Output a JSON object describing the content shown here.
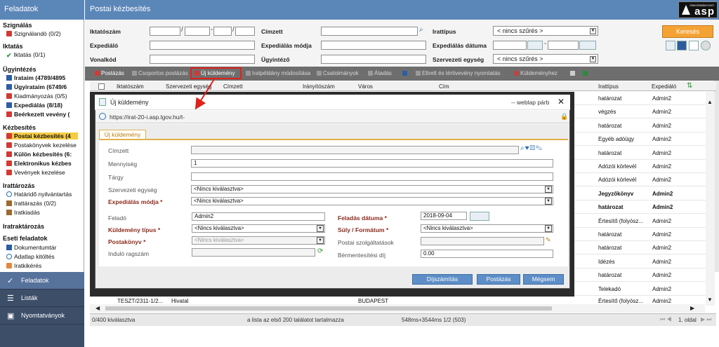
{
  "sidebar": {
    "title": "Feladatok",
    "sections": [
      {
        "title": "Szignálás",
        "items": [
          {
            "label": "Szignálandó (0/2)",
            "icon": "red-folder-icon"
          }
        ]
      },
      {
        "title": "Iktatás",
        "items": [
          {
            "label": "Iktatás (0/1)",
            "icon": "check-icon"
          }
        ]
      },
      {
        "title": "Ügyintézés",
        "items": [
          {
            "label": "Irataim (4789/4895",
            "icon": "blue-doc-icon"
          },
          {
            "label": "Ügyirataim (6749/6",
            "icon": "blue-doc-icon"
          },
          {
            "label": "Kiadmányozás (0/5)",
            "icon": "red-doc-icon"
          },
          {
            "label": "Expediálás (8/18)",
            "icon": "blue-doc-icon"
          },
          {
            "label": "Beérkezett vevény (",
            "icon": "red-doc-icon"
          }
        ]
      },
      {
        "title": "Kézbesítés",
        "items": [
          {
            "label": "Postai kézbesítés (4",
            "icon": "red-doc-icon"
          },
          {
            "label": "Postakönyvek kezelése",
            "icon": "red-doc-icon"
          },
          {
            "label": "Külön kézbesítés (6:",
            "icon": "red-doc-icon"
          },
          {
            "label": "Elektronikus kézbes",
            "icon": "red-doc-icon"
          },
          {
            "label": "Vevények kezelése",
            "icon": "red-doc-icon"
          }
        ]
      },
      {
        "title": "Irattározás",
        "items": [
          {
            "label": "Határidő nyilvántartás",
            "icon": "clock-icon"
          },
          {
            "label": "Irattárazás (0/2)",
            "icon": "box-icon"
          },
          {
            "label": "Iratkiadás",
            "icon": "box-icon"
          }
        ]
      },
      {
        "title": "Iratraktározás",
        "items": []
      },
      {
        "title": "Eseti feladatok",
        "items": [
          {
            "label": "Dokumentumtár",
            "icon": "word-icon"
          },
          {
            "label": "Adatlap kitöltés",
            "icon": "form-icon"
          },
          {
            "label": "Iratkikérés",
            "icon": "request-icon"
          }
        ]
      }
    ],
    "nav": [
      {
        "label": "Feladatok",
        "icon": "check-icon"
      },
      {
        "label": "Listák",
        "icon": "list-icon"
      },
      {
        "label": "Nyomtatványok",
        "icon": "form-icon"
      }
    ]
  },
  "header": {
    "title": "Postai kézbesítés",
    "logo_text": "asp",
    "logo_small": "ÖNKORMÁNYZATI"
  },
  "filters": {
    "iktatoszam": "Iktatószám",
    "expedialo": "Expediáló",
    "vonalkod": "Vonalkód",
    "cimzett": "Címzett",
    "expedialas_modja": "Expediálás módja",
    "ugyintezo": "Ügyintéző",
    "irattipus": "Irattípus",
    "irattipus_value": "< nincs szűrés >",
    "expedialas_datuma": "Expediálás dátuma",
    "szervezeti_egyseg": "Szervezeti egység",
    "szervezeti_egyseg_value": "< nincs szűrés >",
    "search_button": "Keresés"
  },
  "toolbar": {
    "postazas": "Postázás",
    "csoportos": "Csoportos postázás",
    "uj_kuldemeny": "Új küldemény",
    "iratpeldany": "Iratpéldány módosítása",
    "csatolmanyok": "Csatolmányok",
    "atadas": "Átadás",
    "eltrett": "Eltrett és tértivevény nyomtatás",
    "kuldemenyhez": "Küldeményhez"
  },
  "grid": {
    "headers": [
      "Iktatószám",
      "Szervezeti egység",
      "Címzett",
      "Irányítószám",
      "Város",
      "Cím",
      "Irattípus",
      "Expediáló"
    ],
    "rows": [
      {
        "irattipus": "határozat",
        "expedialo": "Admin2",
        "bold": false
      },
      {
        "irattipus": "végzés",
        "expedialo": "Admin2",
        "bold": false
      },
      {
        "irattipus": "határozat",
        "expedialo": "Admin2",
        "bold": false
      },
      {
        "irattipus": "Egyéb adóügy",
        "expedialo": "Admin2",
        "bold": false
      },
      {
        "irattipus": "határozat",
        "expedialo": "Admin2",
        "bold": false
      },
      {
        "irattipus": "Adózói körlevél",
        "expedialo": "Admin2",
        "bold": false
      },
      {
        "irattipus": "Adózói körlevél",
        "expedialo": "Admin2",
        "bold": false
      },
      {
        "irattipus": "Jegyzőkönyv",
        "expedialo": "Admin2",
        "bold": true
      },
      {
        "irattipus": "határozat",
        "expedialo": "Admin2",
        "bold": true
      },
      {
        "irattipus": "Értesítő (folyósz...",
        "expedialo": "Admin2",
        "bold": false
      },
      {
        "irattipus": "határozat",
        "expedialo": "Admin2",
        "bold": false
      },
      {
        "irattipus": "határozat",
        "expedialo": "Admin2",
        "bold": false
      },
      {
        "irattipus": "Idézés",
        "expedialo": "Admin2",
        "bold": false
      },
      {
        "irattipus": "határozat",
        "expedialo": "Admin2",
        "bold": false
      },
      {
        "irattipus": "Telekadó",
        "expedialo": "Admin2",
        "bold": false
      }
    ],
    "last_row": {
      "iktatoszam": "TESZT/2311-1/2...",
      "szervezeti": "Hivatal",
      "varos": "BUDAPEST",
      "irattipus": "Értesítő (folyósz...",
      "expedialo": "Admin2"
    }
  },
  "status": {
    "selected": "0/400 kiválasztva",
    "info": "a lista az első 200 találatot tartalmazza",
    "timing": "548ms+3544ms 1/2 (503)",
    "page": "1. oldal"
  },
  "modal": {
    "title": "Új küldemény",
    "title_right": "-- weblap párb",
    "url": "https://irat-20-i.asp.lgov.hu/t-",
    "tab": "Új küldemény",
    "fields": {
      "cimzett": "Címzett",
      "mennyiseg": "Mennyiség",
      "mennyiseg_value": "1",
      "targy": "Tárgy",
      "szervezeti_egyseg": "Szervezeti egység",
      "szervezeti_value": "<Nincs kiválasztva>",
      "expedialas_modja": "Expediálás módja *",
      "expedialas_value": "<Nincs kiválasztva>",
      "felado": "Feladó",
      "felado_value": "Admin2",
      "kuldemeny_tipus": "Küldemény típus *",
      "kuldemeny_value": "<Nincs kiválasztva>",
      "postakonyv": "Postakönyv *",
      "postakonyv_value": "<Nincs kiválasztva>",
      "indulo_ragszam": "Induló ragszám",
      "feladas_datuma": "Feladás dátuma *",
      "feladas_value": "2018-09-04",
      "suly": "Súly / Formátum *",
      "suly_value": "<Nincs kiválasztva>",
      "postai_szolg": "Postai szolgáltatások",
      "bermentesitesi": "Bérmentesítési díj",
      "bermentesitesi_value": "0.00"
    },
    "buttons": {
      "dijszamitas": "Díjszámítás",
      "postazas": "Postázás",
      "megsem": "Mégsem"
    }
  },
  "colors": {
    "header_blue": "#5b86b8",
    "accent_orange": "#f5a235",
    "highlight_red": "#e0221b",
    "selected_yellow": "#f6cc43"
  }
}
